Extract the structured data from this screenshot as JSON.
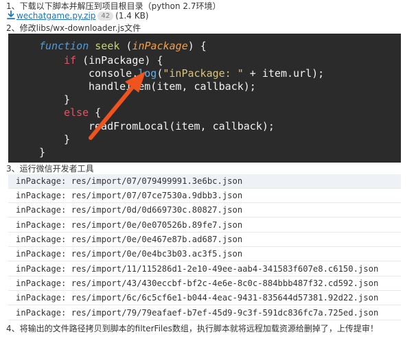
{
  "steps": {
    "step1": "1、下载以下脚本并解压到项目根目录（python 2.7环境）",
    "step2": "2、修改libs/wx-downloader.js文件",
    "step3": "3、运行微信开发者工具",
    "step4": "4、将输出的文件路径拷贝到脚本的filterFiles数组，执行脚本就将远程加载资源给删掉了，上传提审！"
  },
  "download": {
    "icon": "download-icon",
    "filename": "wechatgame.py.zip",
    "count": "42",
    "size": "(1.4 KB)"
  },
  "code": {
    "kw_function": "function",
    "fn_seek": "seek",
    "open_paren": " (",
    "param": "inPackage",
    "close_brace_open": ") {",
    "kw_if": "if",
    "if_cond": " (inPackage) {",
    "console": "console.",
    "log": "log",
    "log_open": "(",
    "log_str": "\"inPackage: \"",
    "log_rest": " + item.url);",
    "handle": "handleItem(item, callback);",
    "close1": "}",
    "kw_else": "else",
    "else_brace": " {",
    "read": "readFromLocal(item, callback);",
    "close2": "}",
    "close3": "}"
  },
  "log_rows": [
    "inPackage: res/import/07/079499991.3e6bc.json",
    "inPackage: res/import/07/07ce7530a.9dbb3.json",
    "inPackage: res/import/0d/0d669730c.80827.json",
    "inPackage: res/import/0e/0e070526b.89fe7.json",
    "inPackage: res/import/0e/0e467e87b.ad687.json",
    "inPackage: res/import/0e/0e4bc3b03.ac3f5.json",
    "inPackage: res/import/11/115286d1-2e10-49ee-aab4-341583f607e8.c6150.json",
    "inPackage: res/import/43/430eccbf-bf2c-4e6e-8c0c-884bbb487f32.cd592.json",
    "inPackage: res/import/6c/6c5cf6e1-b044-4eac-9431-835644d57381.92d22.json",
    "inPackage: res/import/79/79eafaef-b7ef-45d9-9c3f-591dc836fc7a.725ed.json"
  ],
  "colors": {
    "code_bg": "#2b2b2b",
    "arrow": "#f0541e",
    "link": "#1a74c0",
    "row_highlight": "#eef1f6"
  }
}
